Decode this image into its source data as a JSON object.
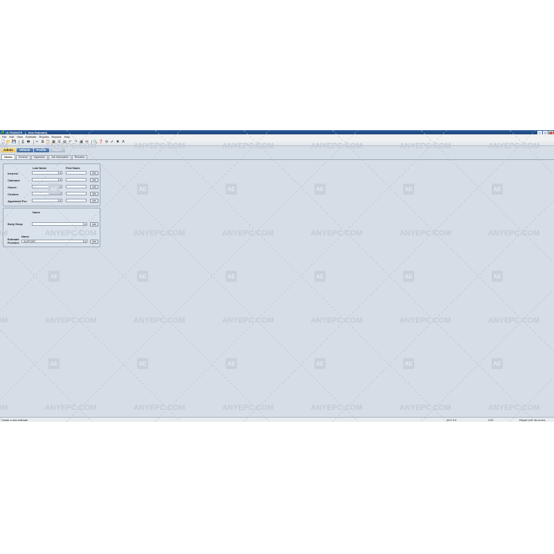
{
  "window": {
    "title": "ULTRAMATE - [ - New Estimate]"
  },
  "menu": [
    "File",
    "Edit",
    "View",
    "Estimate",
    "Reports",
    "Reports",
    "Help"
  ],
  "toolbar_icons": [
    "new-file-icon",
    "open-folder-icon",
    "save-icon",
    "print-icon",
    "print-preview-icon",
    "cut-icon",
    "copy-icon",
    "paste-icon",
    "grid-icon",
    "list-icon",
    "calculator-icon",
    "undo-icon",
    "redo-icon",
    "photo-icon",
    "mail-icon",
    "search-icon",
    "help-icon",
    "settings-icon",
    "check-icon",
    "close-icon",
    "font-icon"
  ],
  "module_tabs": [
    {
      "label": "Admin",
      "state": "active"
    },
    {
      "label": "Vehicle",
      "state": "normal"
    },
    {
      "label": "Profile",
      "state": "normal"
    },
    {
      "label": "Repair",
      "state": "disabled"
    }
  ],
  "sub_tabs": [
    "Names",
    "General",
    "Inspection",
    "Job Information",
    "Remarks"
  ],
  "names_panel": {
    "col_last": "Last Name",
    "col_first": "First Name",
    "rows": [
      {
        "label": "Insured:",
        "button": "###"
      },
      {
        "label": "Claimant:",
        "button": "###"
      },
      {
        "label": "Owner:",
        "button": "###"
      },
      {
        "label": "Custom:",
        "button": "###"
      },
      {
        "label": "Appraised For:",
        "button": "###"
      }
    ]
  },
  "shop_panel": {
    "col_name": "Name",
    "body_shop_label": "Body Shop:",
    "body_shop_button": "###",
    "provider_col": "Name",
    "provider_label": "Estimate Provider:",
    "provider_value": "SUPPORT",
    "provider_button": "###"
  },
  "status": {
    "left": "Create a new estimate",
    "version": "ACV 9.0",
    "code": "0.00",
    "right": "Repair Line: No errors"
  },
  "watermark_text": "ANYEPC.COM",
  "watermark_logo": "AE"
}
